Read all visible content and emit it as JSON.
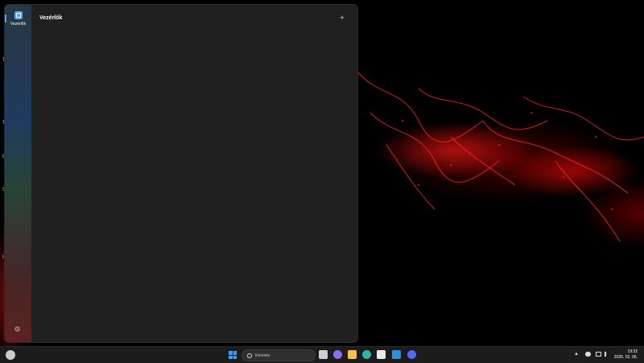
{
  "panel": {
    "rail_label": "Vezérlők",
    "title": "Vezérlők",
    "add_glyph": "+",
    "settings_glyph": "⚙"
  },
  "desktop_edge": [
    "T",
    "Ta",
    "G",
    "Sc",
    "I"
  ],
  "taskbar": {
    "search_placeholder": "Keresés",
    "clock_time": "19:32",
    "clock_date": "2025. 02. 06.",
    "apps": [
      {
        "name": "task-view-icon",
        "color": "#cfcfcf"
      },
      {
        "name": "copilot-icon",
        "color": "#8e6cf0"
      },
      {
        "name": "file-explorer-icon",
        "color": "#f2c14e"
      },
      {
        "name": "edge-icon",
        "color": "#2fb3a6"
      },
      {
        "name": "store-icon",
        "color": "#eaeaea"
      },
      {
        "name": "photos-icon",
        "color": "#2f8fe0"
      },
      {
        "name": "discord-icon",
        "color": "#5865f2"
      }
    ]
  },
  "colors": {
    "accent": "#5aa3e6",
    "panel_bg": "#202020",
    "taskbar_bg": "#1c1c1c"
  }
}
